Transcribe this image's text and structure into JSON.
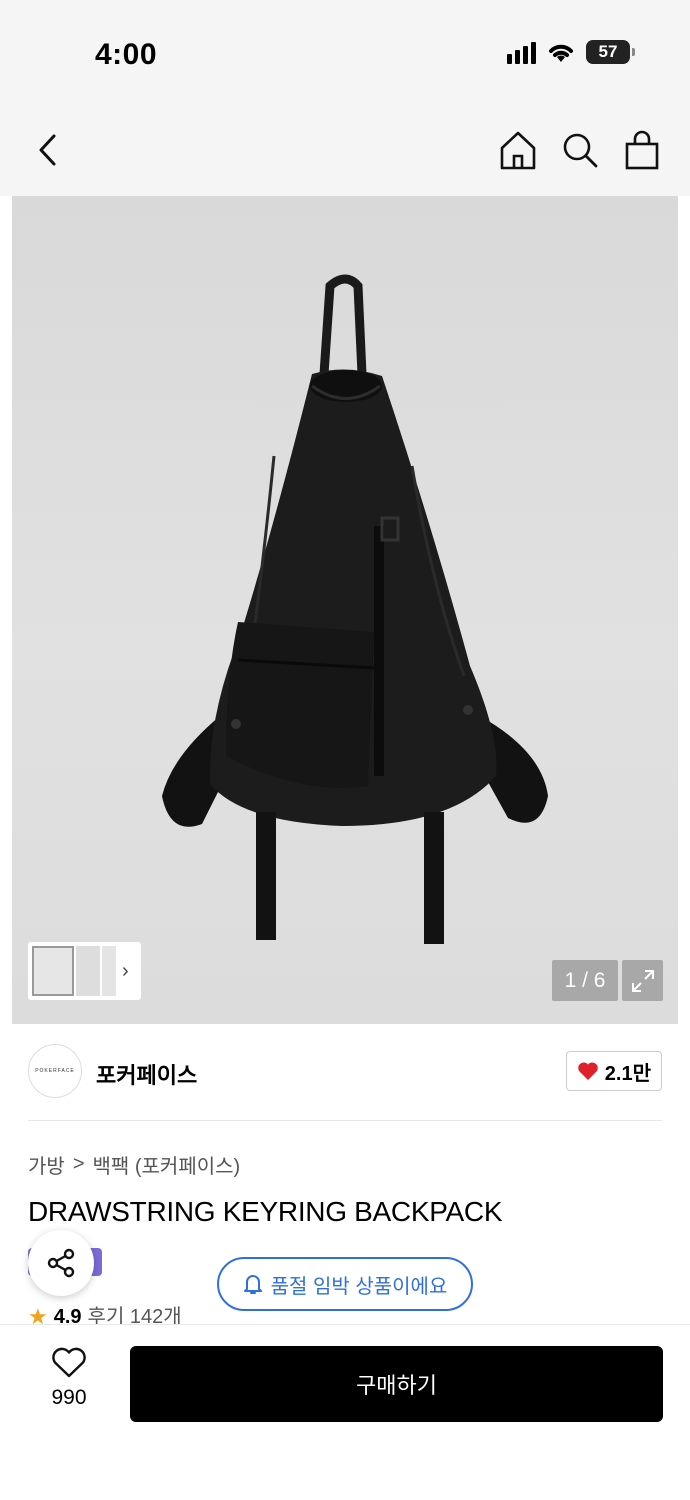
{
  "status_bar": {
    "time": "4:00",
    "battery": "57"
  },
  "nav": {
    "icons": [
      "back-chevron-icon",
      "home-icon",
      "search-icon",
      "shopping-bag-icon"
    ]
  },
  "gallery": {
    "page_counter": "1 / 6",
    "thumbnail_chevron": "›"
  },
  "brand": {
    "logo_text": "POKERFACE",
    "name": "포커페이스",
    "likes": "2.1만"
  },
  "breadcrumb": {
    "category": "가방",
    "separator": ">",
    "subcategory": "백팩 (포커페이스)"
  },
  "product": {
    "title": "DRAWSTRING KEYRING BACKPACK"
  },
  "notice": {
    "soldout_text": "품절 임박 상품이에요"
  },
  "rating": {
    "score": "4.9",
    "reviews": "후기 142개"
  },
  "bottom_bar": {
    "wish_count": "990",
    "buy_label": "구매하기"
  },
  "colors": {
    "accent_blue": "#2f6fe0",
    "heart_red": "#e0202a",
    "star_orange": "#f0a21b",
    "tag_purple": "#7b6bd6"
  }
}
